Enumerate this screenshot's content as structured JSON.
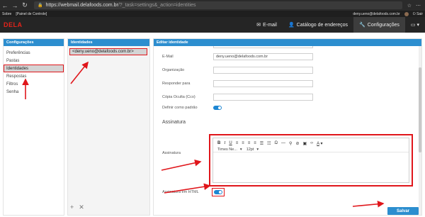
{
  "browser": {
    "url_main": "https://webmail.delafoods.com.br",
    "url_rest": "/?_task=settings&_action=identities",
    "back_icon": "arrow-left-icon",
    "forward_icon": "arrow-right-icon",
    "reload_icon": "reload-icon"
  },
  "top_strip": {
    "about": "Sobre",
    "control_panel": "[Painel de Controle]",
    "user_email": "deny.ueno@delafoods.com.br",
    "logout": "Sair"
  },
  "header": {
    "logo": "DELA",
    "nav": [
      {
        "label": "E-mail",
        "icon": "envelope-icon"
      },
      {
        "label": "Catálogo de endereços",
        "icon": "contacts-icon"
      },
      {
        "label": "Configurações",
        "icon": "wrench-icon"
      }
    ]
  },
  "settings": {
    "title": "Configurações",
    "items": [
      "Preferências",
      "Pastas",
      "Identidades",
      "Respostas",
      "Filtros",
      "Senha"
    ],
    "selected": "Identidades"
  },
  "identities": {
    "title": "Identidades",
    "items": [
      "<deny.ueno@delafoods.com.br>"
    ],
    "add_icon": "plus-icon",
    "delete_icon": "close-icon"
  },
  "editor": {
    "title": "Editar identidade",
    "email_label": "E-Mail",
    "email_value": "deny.ueno@delafoods.com.br",
    "org_label": "Organização",
    "reply_label": "Responder para",
    "bcc_label": "Cópia Oculta (Cco)",
    "default_label": "Definir como padrão",
    "signature_section": "Assinatura",
    "signature_label": "Assinatura",
    "html_signature_label": "Assinatura em HTML",
    "font_family": "Times Ne...",
    "font_size": "12pt",
    "save_label": "Salvar"
  },
  "colors": {
    "accent": "#2c8ecf",
    "highlight": "#e0161b",
    "header_bg": "#252525"
  }
}
